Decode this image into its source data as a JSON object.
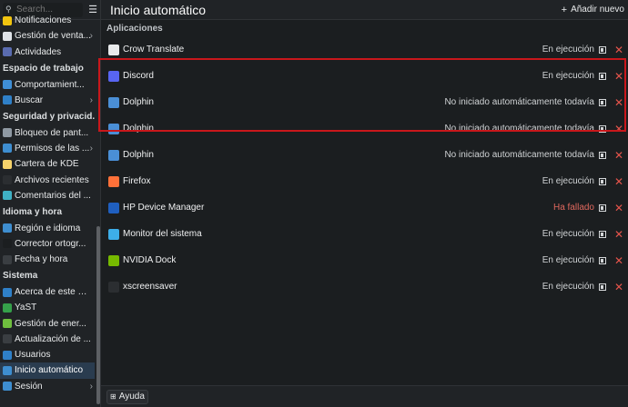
{
  "search": {
    "placeholder": "Search..."
  },
  "sidebar": {
    "items": [
      {
        "label": "Notificaciones",
        "icon": "bell-icon",
        "color": "#f1c40f"
      },
      {
        "label": "Gestión de venta...",
        "icon": "window-management-icon",
        "color": "#dfe3e8",
        "chevron": true
      },
      {
        "label": "Actividades",
        "icon": "activities-icon",
        "color": "#5a6cb0"
      }
    ],
    "sections": [
      {
        "title": "Espacio de trabajo",
        "items": [
          {
            "label": "Comportamient...",
            "icon": "workspace-behavior-icon",
            "color": "#3f8fd6"
          },
          {
            "label": "Buscar",
            "icon": "search-settings-icon",
            "color": "#2f80c8",
            "chevron": true
          }
        ]
      },
      {
        "title": "Seguridad y privacid...",
        "items": [
          {
            "label": "Bloqueo de pant...",
            "icon": "screen-lock-icon",
            "color": "#8f99a3"
          },
          {
            "label": "Permisos de las ...",
            "icon": "shield-icon",
            "color": "#3e8ed0",
            "chevron": true
          },
          {
            "label": "Cartera de KDE",
            "icon": "wallet-icon",
            "color": "#f6d36b"
          },
          {
            "label": "Archivos recientes",
            "icon": "recent-files-icon",
            "color": "#2b2e31"
          },
          {
            "label": "Comentarios del ...",
            "icon": "feedback-icon",
            "color": "#3fb1c5"
          }
        ]
      },
      {
        "title": "Idioma y hora",
        "items": [
          {
            "label": "Región e idioma",
            "icon": "flag-icon",
            "color": "#3e8ed0"
          },
          {
            "label": "Corrector ortogr...",
            "icon": "spellcheck-icon",
            "color": "#1b1e20"
          },
          {
            "label": "Fecha y hora",
            "icon": "clock-icon",
            "color": "#3a3e42"
          }
        ]
      },
      {
        "title": "Sistema",
        "items": [
          {
            "label": "Acerca de este si...",
            "icon": "info-icon",
            "color": "#2f80c8"
          },
          {
            "label": "YaST",
            "icon": "yast-icon",
            "color": "#35a04a"
          },
          {
            "label": "Gestión de ener...",
            "icon": "power-icon",
            "color": "#6fbe3e"
          },
          {
            "label": "Actualización de ...",
            "icon": "update-icon",
            "color": "#3a3e42"
          },
          {
            "label": "Usuarios",
            "icon": "users-icon",
            "color": "#2f80c8"
          },
          {
            "label": "Inicio automático",
            "icon": "autostart-icon",
            "color": "#3e8ed0",
            "active": true
          },
          {
            "label": "Sesión",
            "icon": "session-icon",
            "color": "#3e8ed0",
            "chevron": true
          }
        ]
      }
    ]
  },
  "header": {
    "title": "Inicio automático",
    "add_label": "Añadir nuevo"
  },
  "main": {
    "section_title": "Aplicaciones",
    "rows": [
      {
        "name": "Crow Translate",
        "status": "En ejecución",
        "icon": "crow-translate-icon",
        "color": "#e8eaeb",
        "failed": false
      },
      {
        "name": "Discord",
        "status": "En ejecución",
        "icon": "discord-icon",
        "color": "#5865f2",
        "failed": false
      },
      {
        "name": "Dolphin",
        "status": "No iniciado automáticamente todavía",
        "icon": "folder-icon",
        "color": "#4a8fd6",
        "failed": false
      },
      {
        "name": "Dolphin",
        "status": "No iniciado automáticamente todavía",
        "icon": "folder-icon",
        "color": "#4a8fd6",
        "failed": false
      },
      {
        "name": "Dolphin",
        "status": "No iniciado automáticamente todavía",
        "icon": "folder-icon",
        "color": "#4a8fd6",
        "failed": false
      },
      {
        "name": "Firefox",
        "status": "En ejecución",
        "icon": "firefox-icon",
        "color": "#ff7139",
        "failed": false
      },
      {
        "name": "HP Device Manager",
        "status": "Ha fallado",
        "icon": "hp-icon",
        "color": "#1f5fbf",
        "failed": true
      },
      {
        "name": "Monitor del sistema",
        "status": "En ejecución",
        "icon": "system-monitor-icon",
        "color": "#3daee9",
        "failed": false
      },
      {
        "name": "NVIDIA Dock",
        "status": "En ejecución",
        "icon": "nvidia-icon",
        "color": "#76b900",
        "failed": false
      },
      {
        "name": "xscreensaver",
        "status": "En ejecución",
        "icon": "terminal-icon",
        "color": "#2b2e31",
        "failed": false
      }
    ]
  },
  "footer": {
    "help_label": "Ayuda"
  }
}
